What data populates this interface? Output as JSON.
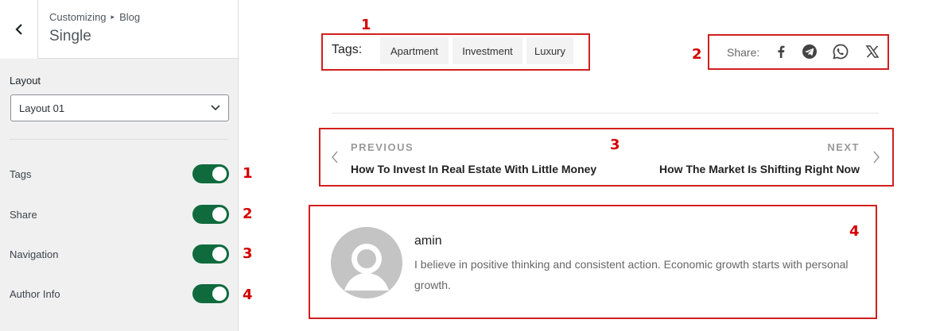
{
  "sidebar": {
    "breadcrumb": {
      "root": "Customizing",
      "section": "Blog"
    },
    "title": "Single",
    "layout": {
      "label": "Layout",
      "selected": "Layout 01"
    },
    "toggles": [
      {
        "label": "Tags",
        "on": true,
        "marker": "1"
      },
      {
        "label": "Share",
        "on": true,
        "marker": "2"
      },
      {
        "label": "Navigation",
        "on": true,
        "marker": "3"
      },
      {
        "label": "Author Info",
        "on": true,
        "marker": "4"
      }
    ]
  },
  "main": {
    "markers": [
      "1",
      "2",
      "3",
      "4"
    ],
    "tags": {
      "label": "Tags:",
      "items": [
        "Apartment",
        "Investment",
        "Luxury"
      ]
    },
    "share": {
      "label": "Share:",
      "icons": [
        "facebook-icon",
        "telegram-icon",
        "whatsapp-icon",
        "x-icon"
      ]
    },
    "navigation": {
      "prev_label": "PREVIOUS",
      "prev_title": "How To Invest In Real Estate With Little Money",
      "next_label": "NEXT",
      "next_title": "How The Market Is Shifting Right Now"
    },
    "author": {
      "name": "amin",
      "bio": "I believe in positive thinking and consistent action. Economic growth starts with personal growth."
    }
  },
  "colors": {
    "toggle_on": "#0f6b3e",
    "annotation_red": "#d21f1f"
  }
}
